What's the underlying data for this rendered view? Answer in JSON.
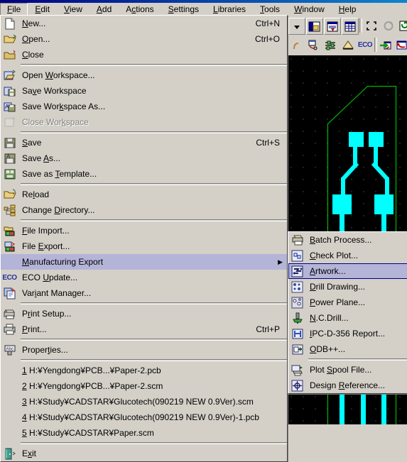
{
  "window": {
    "title_bar_color": "#000080"
  },
  "menubar": {
    "items": [
      {
        "label": "File",
        "mnemonic": "F",
        "active": true
      },
      {
        "label": "Edit",
        "mnemonic": "E",
        "active": false
      },
      {
        "label": "View",
        "mnemonic": "V",
        "active": false
      },
      {
        "label": "Add",
        "mnemonic": "A",
        "active": false
      },
      {
        "label": "Actions",
        "mnemonic": "c",
        "active": false
      },
      {
        "label": "Settings",
        "mnemonic": "S",
        "active": false
      },
      {
        "label": "Libraries",
        "mnemonic": "L",
        "active": false
      },
      {
        "label": "Tools",
        "mnemonic": "T",
        "active": false
      },
      {
        "label": "Window",
        "mnemonic": "W",
        "active": false
      },
      {
        "label": "Help",
        "mnemonic": "H",
        "active": false
      }
    ]
  },
  "file_menu": {
    "items": [
      {
        "type": "item",
        "label": "New...",
        "accel": "Ctrl+N",
        "icon": "new-document-icon",
        "state": "normal"
      },
      {
        "type": "item",
        "label": "Open...",
        "accel": "Ctrl+O",
        "icon": "open-folder-icon",
        "state": "normal"
      },
      {
        "type": "item",
        "label": "Close",
        "accel": "",
        "icon": "close-folder-icon",
        "state": "normal"
      },
      {
        "type": "separator"
      },
      {
        "type": "item",
        "label": "Open Workspace...",
        "accel": "",
        "icon": "open-workspace-icon",
        "state": "normal"
      },
      {
        "type": "item",
        "label": "Save Workspace",
        "accel": "",
        "icon": "save-workspace-icon",
        "state": "normal"
      },
      {
        "type": "item",
        "label": "Save Workspace As...",
        "accel": "",
        "icon": "save-workspace-as-icon",
        "state": "normal"
      },
      {
        "type": "item",
        "label": "Close Workspace",
        "accel": "",
        "icon": "close-workspace-icon",
        "state": "disabled"
      },
      {
        "type": "separator"
      },
      {
        "type": "item",
        "label": "Save",
        "accel": "Ctrl+S",
        "icon": "floppy-save-icon",
        "state": "normal"
      },
      {
        "type": "item",
        "label": "Save As...",
        "accel": "",
        "icon": "save-as-icon",
        "state": "normal"
      },
      {
        "type": "item",
        "label": "Save as Template...",
        "accel": "",
        "icon": "save-template-icon",
        "state": "normal"
      },
      {
        "type": "separator"
      },
      {
        "type": "item",
        "label": "Reload",
        "accel": "",
        "icon": "reload-folder-icon",
        "state": "normal"
      },
      {
        "type": "item",
        "label": "Change Directory...",
        "accel": "",
        "icon": "change-directory-icon",
        "state": "normal"
      },
      {
        "type": "separator"
      },
      {
        "type": "item",
        "label": "File Import...",
        "accel": "",
        "icon": "file-import-icon",
        "state": "normal"
      },
      {
        "type": "item",
        "label": "File Export...",
        "accel": "",
        "icon": "file-export-icon",
        "state": "normal"
      },
      {
        "type": "submenu",
        "label": "Manufacturing Export",
        "accel": "",
        "icon": "none",
        "state": "selected"
      },
      {
        "type": "item",
        "label": "ECO Update...",
        "accel": "",
        "icon": "eco-icon",
        "state": "normal"
      },
      {
        "type": "item",
        "label": "Variant Manager...",
        "accel": "",
        "icon": "variant-manager-icon",
        "state": "normal"
      },
      {
        "type": "separator"
      },
      {
        "type": "item",
        "label": "Print Setup...",
        "accel": "",
        "icon": "print-setup-icon",
        "state": "normal"
      },
      {
        "type": "item",
        "label": "Print...",
        "accel": "Ctrl+P",
        "icon": "printer-icon",
        "state": "normal"
      },
      {
        "type": "separator"
      },
      {
        "type": "item",
        "label": "Properties...",
        "accel": "",
        "icon": "properties-abc-icon",
        "state": "normal"
      },
      {
        "type": "separator"
      },
      {
        "type": "recent",
        "label": "1 H:¥Yengdong¥PCB...¥Paper-2.pcb",
        "accel": "",
        "icon": "none",
        "state": "normal"
      },
      {
        "type": "recent",
        "label": "2 H:¥Yengdong¥PCB...¥Paper-2.scm",
        "accel": "",
        "icon": "none",
        "state": "normal"
      },
      {
        "type": "recent",
        "label": "3 H:¥Study¥CADSTAR¥Glucotech(090219 NEW 0.9Ver).scm",
        "accel": "",
        "icon": "none",
        "state": "normal"
      },
      {
        "type": "recent",
        "label": "4 H:¥Study¥CADSTAR¥Glucotech(090219 NEW 0.9Ver)-1.pcb",
        "accel": "",
        "icon": "none",
        "state": "normal"
      },
      {
        "type": "recent",
        "label": "5 H:¥Study¥CADSTAR¥Paper.scm",
        "accel": "",
        "icon": "none",
        "state": "normal"
      },
      {
        "type": "separator"
      },
      {
        "type": "item",
        "label": "Exit",
        "accel": "",
        "icon": "exit-door-icon",
        "state": "normal"
      }
    ]
  },
  "manufacturing_export_submenu": {
    "items": [
      {
        "type": "item",
        "label": "Batch Process...",
        "icon": "batch-process-icon",
        "state": "normal"
      },
      {
        "type": "item",
        "label": "Check Plot...",
        "icon": "check-plot-icon",
        "state": "normal"
      },
      {
        "type": "item",
        "label": "Artwork...",
        "icon": "artwork-icon",
        "state": "selected"
      },
      {
        "type": "item",
        "label": "Drill Drawing...",
        "icon": "drill-drawing-icon",
        "state": "normal"
      },
      {
        "type": "item",
        "label": "Power Plane...",
        "icon": "power-plane-icon",
        "state": "normal"
      },
      {
        "type": "item",
        "label": "N.C.Drill...",
        "icon": "nc-drill-icon",
        "state": "normal"
      },
      {
        "type": "item",
        "label": "IPC-D-356 Report...",
        "icon": "ipc-report-icon",
        "state": "normal"
      },
      {
        "type": "item",
        "label": "ODB++...",
        "icon": "odb-icon",
        "state": "normal"
      },
      {
        "type": "separator"
      },
      {
        "type": "item",
        "label": "Plot Spool File...",
        "icon": "plot-spool-icon",
        "state": "normal"
      },
      {
        "type": "item",
        "label": "Design Reference...",
        "icon": "design-reference-icon",
        "state": "normal"
      }
    ]
  },
  "toolbar": {
    "row1": [
      {
        "name": "dropdown-arrow-button",
        "icon": "chevron-down-icon"
      },
      {
        "name": "open-design-button",
        "icon": "folder-window-icon"
      },
      {
        "name": "report-button",
        "icon": "report-icon"
      },
      {
        "name": "grid-table-button",
        "icon": "grid-table-icon"
      },
      {
        "name": "zoom-fit-button",
        "icon": "zoom-fit-icon"
      },
      {
        "name": "redraw-button",
        "icon": "redraw-icon"
      },
      {
        "name": "refresh-doc-button",
        "icon": "refresh-doc-icon"
      }
    ],
    "row2": [
      {
        "name": "place-component-button",
        "icon": "place-component-icon"
      },
      {
        "name": "route-editor-button",
        "icon": "route-editor-icon"
      },
      {
        "name": "layer-tool-button",
        "icon": "layer-tool-icon"
      },
      {
        "name": "eco-update-button",
        "icon": "eco-text-icon",
        "text": "ECO"
      },
      {
        "name": "forward-xref-button",
        "icon": "forward-crossprobe-icon"
      },
      {
        "name": "back-xref-button",
        "icon": "back-crossprobe-icon"
      }
    ]
  },
  "pcb_view": {
    "background_color": "#000000",
    "grid_dot_color": "#2b2b2b",
    "board_outline_color": "#00d000",
    "trace_color": "#00ffff",
    "pad_color": "#00ffff"
  },
  "colors": {
    "face": "#d4d0c8",
    "menu_highlight": "#b4b4d8",
    "highlight_border": "#000080",
    "disabled_text": "#808080"
  }
}
